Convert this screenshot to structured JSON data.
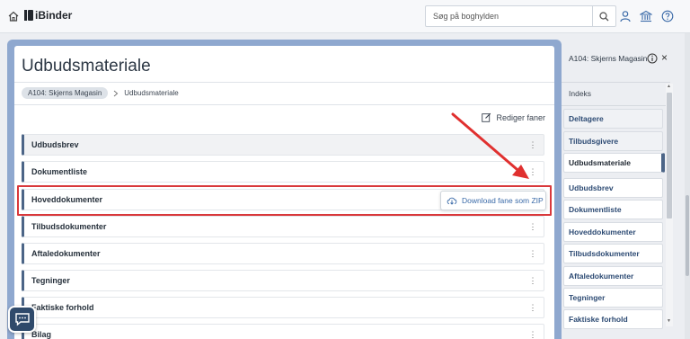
{
  "topbar": {
    "logo_text": "iBinder",
    "search_placeholder": "Søg på boghylden",
    "icons": [
      "home-icon",
      "search-icon",
      "user-icon",
      "library-icon",
      "help-icon"
    ]
  },
  "main": {
    "title": "Udbudsmateriale",
    "breadcrumb": {
      "parent": "A104: Skjerns Magasin",
      "current": "Udbudsmateriale"
    },
    "edit_tabs_label": "Rediger faner",
    "tabs": [
      {
        "label": "Udbudsbrev"
      },
      {
        "label": "Dokumentliste"
      },
      {
        "label": "Hoveddokumenter"
      },
      {
        "label": "Tilbudsdokumenter"
      },
      {
        "label": "Aftaledokumenter"
      },
      {
        "label": "Tegninger"
      },
      {
        "label": "Faktiske forhold"
      },
      {
        "label": "Bilag"
      }
    ],
    "zip_popup_label": "Download fane som ZIP",
    "kebab": "⋮"
  },
  "right_panel": {
    "title": "A104: Skjerns Magasin",
    "index_label": "Indeks",
    "upper_items": [
      {
        "label": "Deltagere"
      },
      {
        "label": "Tilbudsgivere"
      },
      {
        "label": "Udbudsmateriale"
      }
    ],
    "lower_items": [
      {
        "label": "Udbudsbrev"
      },
      {
        "label": "Dokumentliste"
      },
      {
        "label": "Hoveddokumenter"
      },
      {
        "label": "Tilbudsdokumenter"
      },
      {
        "label": "Aftaledokumenter"
      },
      {
        "label": "Tegninger"
      },
      {
        "label": "Faktiske forhold"
      }
    ],
    "close_symbol": "×"
  },
  "colors": {
    "accent": "#4c6587",
    "frame": "#8fa8cf",
    "highlight": "#d9383b",
    "link": "#3a6aa8"
  }
}
